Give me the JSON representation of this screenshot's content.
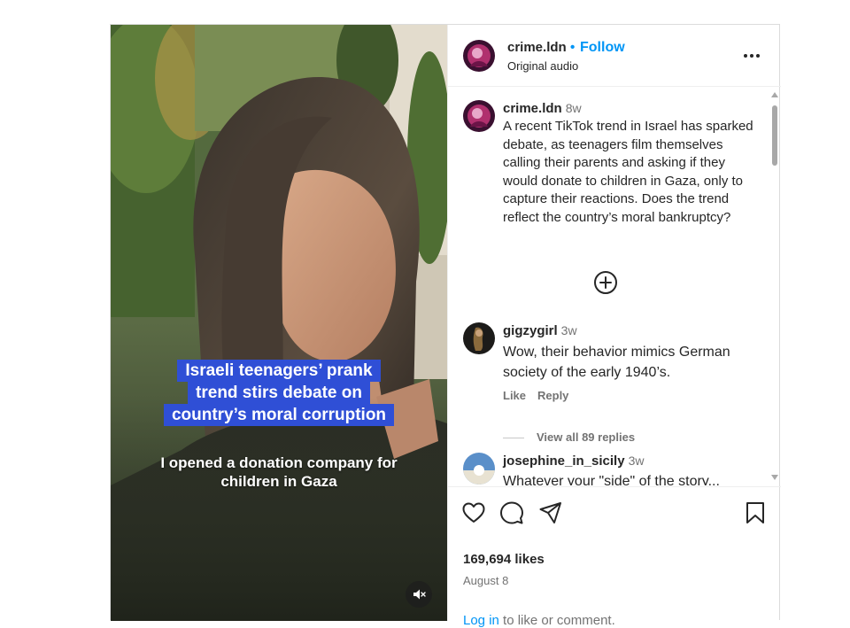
{
  "post": {
    "username": "crime.ldn",
    "follow_dot": "•",
    "follow_label": "Follow",
    "audio_label": "Original audio",
    "media": {
      "headline_lines": [
        "Israeli teenagers’ prank",
        "trend stirs debate on",
        "country’s moral corruption"
      ],
      "subtitle": "I opened a donation company for children in Gaza",
      "headline_bg": "#2f4fd6"
    },
    "caption": {
      "username": "crime.ldn",
      "time": "8w",
      "text": "A recent TikTok trend in Israel has sparked debate, as teenagers film themselves calling their parents and asking if they would donate to children in Gaza, only to capture their reactions. Does the trend reflect the country’s moral bankruptcy?"
    },
    "comments": [
      {
        "username": "gigzygirl",
        "time": "3w",
        "text": "Wow, their behavior mimics German society of the early 1940’s.",
        "like_label": "Like",
        "reply_label": "Reply",
        "view_replies": "View all 89 replies"
      },
      {
        "username": "josephine_in_sicily",
        "time": "3w",
        "text": "Whatever your \"side\" of the story..."
      }
    ],
    "likes": "169,694 likes",
    "date": "August 8",
    "login_link": "Log in",
    "login_rest": " to like or comment.",
    "icons": [
      "heart-icon",
      "comment-icon",
      "share-icon",
      "bookmark-icon",
      "more-icon",
      "add-circle-icon",
      "mute-icon"
    ],
    "colors": {
      "link": "#0095f6",
      "muted": "#737373",
      "text": "#262626"
    }
  }
}
